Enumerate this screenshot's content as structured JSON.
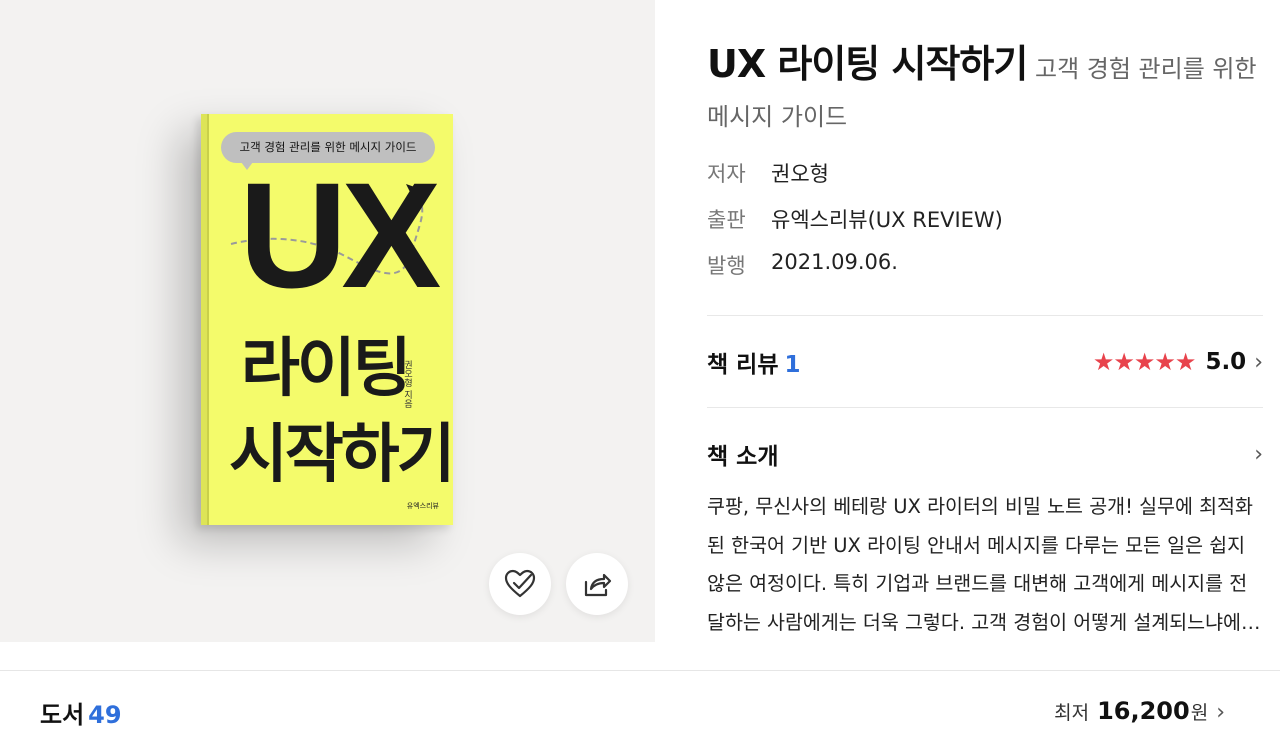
{
  "book_cover": {
    "bubble_text": "고객 경험 관리를 위한 메시지 가이드",
    "title_ux": "UX",
    "title_line1": "라이팅",
    "title_line2": "시작하기",
    "author_vertical": "권오형 지음",
    "publisher": "유엑스리뷰"
  },
  "actions": {
    "like_icon": "heart-check-icon",
    "share_icon": "share-icon"
  },
  "book": {
    "title": "UX 라이팅 시작하기",
    "subtitle": "고객 경험 관리를 위한 메시지 가이드",
    "meta": [
      {
        "label": "저자",
        "value": "권오형"
      },
      {
        "label": "출판",
        "value": "유엑스리뷰(UX REVIEW)"
      },
      {
        "label": "발행",
        "value": "2021.09.06."
      }
    ]
  },
  "review": {
    "label": "책 리뷰",
    "count": "1",
    "stars": "★★★★★",
    "rating": "5.0",
    "chevron": "›",
    "star_color": "#e8434c"
  },
  "intro": {
    "label": "책 소개",
    "chevron": "›",
    "text": "쿠팡, 무신사의 베테랑 UX 라이터의 비밀 노트 공개! 실무에 최적화된 한국어 기반 UX 라이팅 안내서 메시지를 다루는 모든 일은 쉽지 않은 여정이다. 특히 기업과 브랜드를 대변해 고객에게 메시지를 전달하는 사람에게는 더욱 그렇다. 고객 경험이 어떻게 설계되느냐에 따라 브랜드의 이미지가 달라진다."
  },
  "bottom": {
    "category_label": "도서",
    "category_count": "49",
    "price_label": "최저",
    "price_value": "16,200",
    "price_unit": "원",
    "chevron": "›",
    "accent_color": "#2f6fdb"
  }
}
